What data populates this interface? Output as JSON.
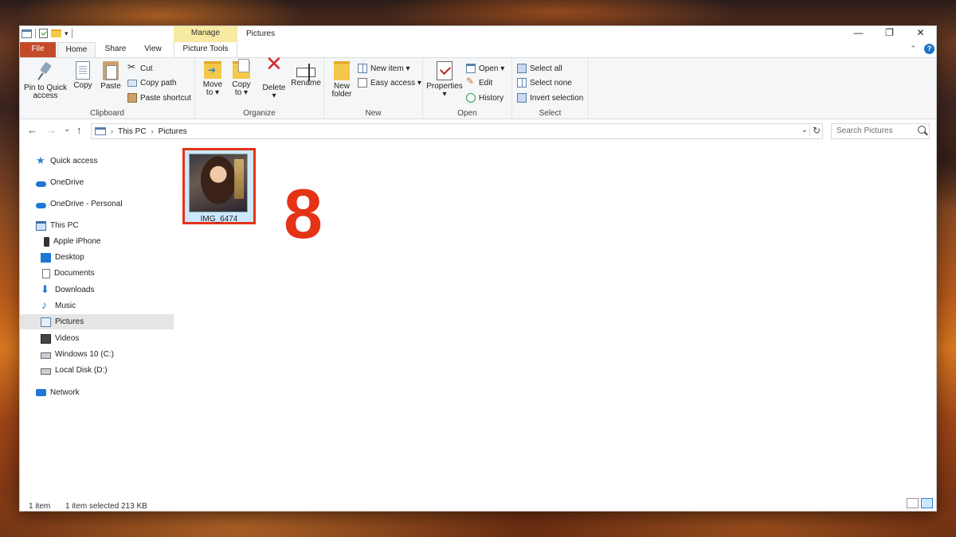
{
  "window": {
    "title": "Pictures",
    "manage_tab": "Manage",
    "controls": {
      "minimize": "—",
      "maximize": "❐",
      "close": "✕"
    }
  },
  "tabs": {
    "file": "File",
    "home": "Home",
    "share": "Share",
    "view": "View",
    "picture_tools": "Picture Tools",
    "help": "?"
  },
  "ribbon": {
    "clipboard": {
      "label": "Clipboard",
      "pin_line1": "Pin to Quick",
      "pin_line2": "access",
      "copy": "Copy",
      "paste": "Paste",
      "cut": "Cut",
      "copy_path": "Copy path",
      "paste_shortcut": "Paste shortcut"
    },
    "organize": {
      "label": "Organize",
      "move_line1": "Move",
      "move_line2": "to ▾",
      "copy_line1": "Copy",
      "copy_line2": "to ▾",
      "delete": "Delete",
      "delete_arrow": "▾",
      "rename": "Rename"
    },
    "new": {
      "label": "New",
      "new_folder_line1": "New",
      "new_folder_line2": "folder",
      "new_item": "New item ▾",
      "easy_access": "Easy access ▾"
    },
    "open": {
      "label": "Open",
      "properties": "Properties",
      "properties_arrow": "▾",
      "open": "Open ▾",
      "edit": "Edit",
      "history": "History"
    },
    "select": {
      "label": "Select",
      "select_all": "Select all",
      "select_none": "Select none",
      "invert": "Invert selection"
    }
  },
  "address": {
    "back": "←",
    "forward": "→",
    "recent": "⌄",
    "up": "↑",
    "crumbs": [
      "This PC",
      "Pictures"
    ],
    "sep": "›",
    "dropdown": "⌄",
    "refresh": "↻",
    "search_placeholder": "Search Pictures"
  },
  "nav": [
    {
      "label": "Quick access",
      "icon": "star-icon"
    },
    {
      "label": "OneDrive",
      "icon": "cloud-icon"
    },
    {
      "label": "OneDrive - Personal",
      "icon": "cloud-icon"
    },
    {
      "label": "This PC",
      "icon": "computer-icon"
    },
    {
      "label": "Apple iPhone",
      "icon": "phone-icon"
    },
    {
      "label": "Desktop",
      "icon": "desktop-icon"
    },
    {
      "label": "Documents",
      "icon": "documents-icon"
    },
    {
      "label": "Downloads",
      "icon": "downloads-icon"
    },
    {
      "label": "Music",
      "icon": "music-icon"
    },
    {
      "label": "Pictures",
      "icon": "pictures-icon",
      "selected": true
    },
    {
      "label": "Videos",
      "icon": "videos-icon"
    },
    {
      "label": "Windows 10 (C:)",
      "icon": "drive-icon"
    },
    {
      "label": "Local Disk (D:)",
      "icon": "drive-icon"
    },
    {
      "label": "Network",
      "icon": "network-icon"
    }
  ],
  "content": {
    "file_name": "IMG_6474",
    "step_number": "8",
    "highlight_color": "#e53317"
  },
  "status": {
    "count": "1 item",
    "selected": "1 item selected  213 KB"
  }
}
